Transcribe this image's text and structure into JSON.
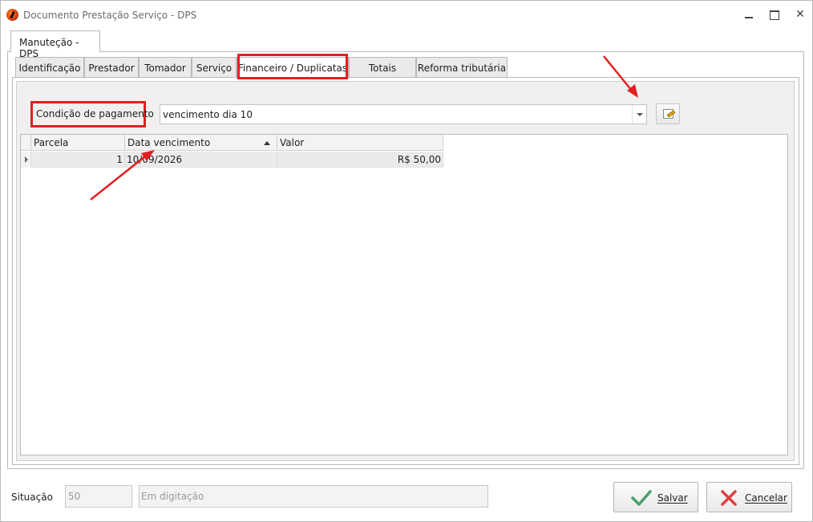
{
  "window": {
    "title": "Documento Prestação Serviço - DPS"
  },
  "outer_tab": {
    "label": "Manuteção - DPS"
  },
  "tabs": [
    {
      "label": "Identificação"
    },
    {
      "label": "Prestador"
    },
    {
      "label": "Tomador"
    },
    {
      "label": "Serviço"
    },
    {
      "label": "Financeiro / Duplicatas",
      "active": true
    },
    {
      "label": "Totais"
    },
    {
      "label": "Reforma tributária"
    }
  ],
  "payment": {
    "label": "Condição de pagamento",
    "value": "vencimento dia 10"
  },
  "grid": {
    "columns": [
      "Parcela",
      "Data vencimento",
      "Valor"
    ],
    "rows": [
      {
        "parcela": "1",
        "data": "10/09/2026",
        "valor": "R$ 50,00"
      }
    ]
  },
  "status": {
    "label": "Situação",
    "code": "50",
    "description": "Em digitação"
  },
  "buttons": {
    "save": "Salvar",
    "cancel": "Cancelar"
  },
  "colors": {
    "highlight": "#e02020",
    "save_check": "#4aa06a",
    "cancel_x": "#e04040"
  },
  "icons": [
    "app-logo-icon",
    "minimize-icon",
    "maximize-icon",
    "close-icon",
    "dropdown-arrow-icon",
    "edit-document-icon",
    "sort-ascending-icon",
    "row-pointer-icon",
    "checkmark-icon",
    "x-icon"
  ]
}
